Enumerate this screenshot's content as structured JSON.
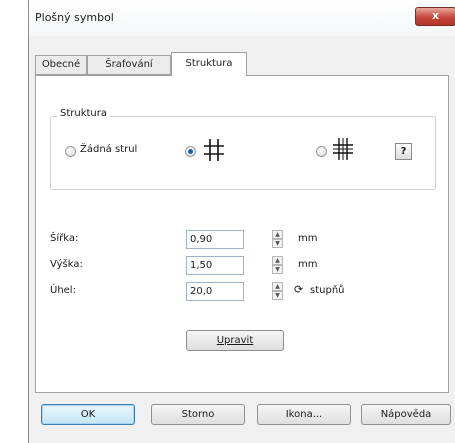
{
  "window": {
    "title": "Plošný symbol",
    "close_label": "x"
  },
  "tabs": [
    {
      "label": "Obecné",
      "active": false
    },
    {
      "label": "Šrafování",
      "active": false
    },
    {
      "label": "Struktura",
      "active": true
    }
  ],
  "structure_group": {
    "legend": "Struktura",
    "options": [
      {
        "label": "Žádná strul",
        "checked": false,
        "icon": "none"
      },
      {
        "label": "",
        "checked": true,
        "icon": "grid-hash-icon"
      },
      {
        "label": "",
        "checked": false,
        "icon": "grid-cross-icon"
      }
    ],
    "help_label": "?"
  },
  "fields": {
    "width": {
      "label": "Šířka:",
      "value": "0,90",
      "unit": "mm"
    },
    "height": {
      "label": "Výška:",
      "value": "1,50",
      "unit": "mm"
    },
    "angle": {
      "label": "Úhel:",
      "value": "20,0",
      "unit": "stupňů",
      "icon": "rotate-icon"
    }
  },
  "edit_button": "Upravit",
  "footer": {
    "ok": "OK",
    "cancel": "Storno",
    "icon": "Ikona...",
    "help": "Nápověda"
  }
}
